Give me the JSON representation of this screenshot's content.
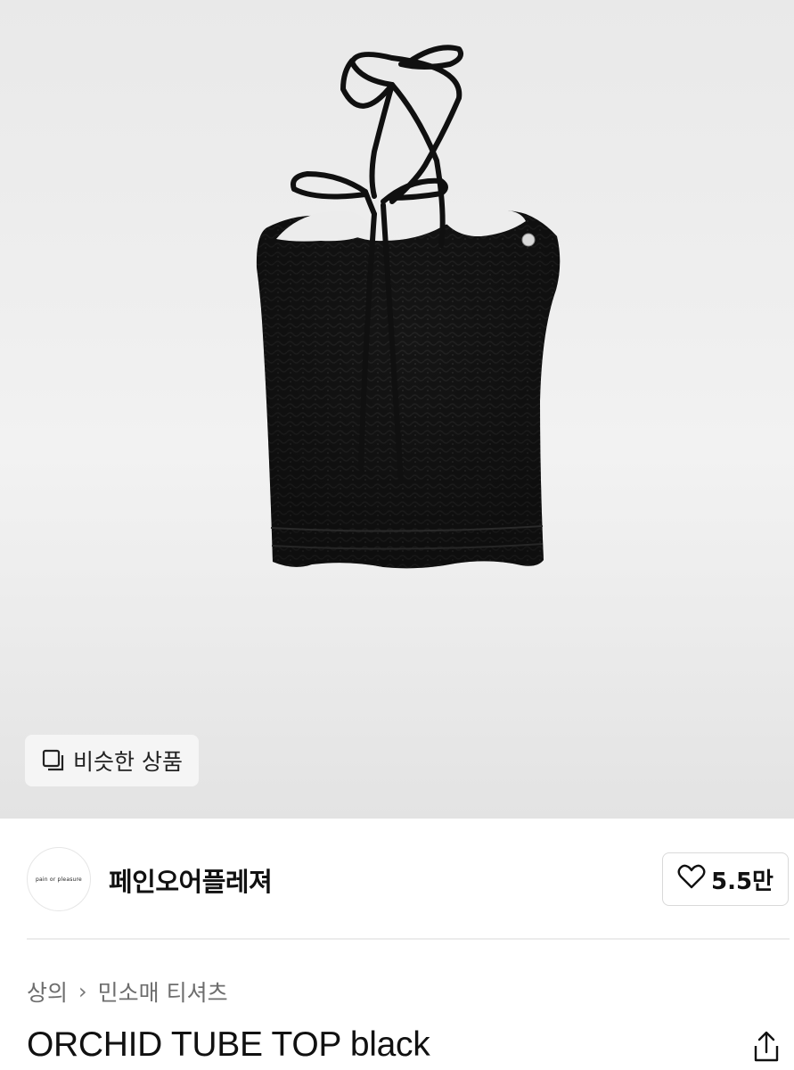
{
  "hero": {
    "product_image": "black-halter-tube-top-photo",
    "similar_button": {
      "icon": "similar-items-icon",
      "label": "비슷한 상품"
    }
  },
  "seller": {
    "avatar_text": "pain or pleasure",
    "name": "페인오어플레져",
    "like": {
      "icon": "heart-icon",
      "count": "5.5만"
    }
  },
  "breadcrumb": {
    "category": "상의",
    "separator": "›",
    "subcategory": "민소매 티셔츠"
  },
  "product": {
    "title": "ORCHID TUBE TOP black",
    "share_icon": "share-icon"
  }
}
